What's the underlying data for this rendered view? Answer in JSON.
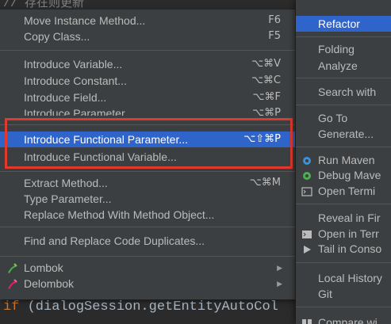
{
  "editor": {
    "top_comment": "// 存在则更新",
    "bottom_code_kw": "if",
    "bottom_code_rest": " (dialogSession.getEntityAutoCol"
  },
  "refactor_menu": {
    "items": [
      {
        "label": "Move Instance Method...",
        "shortcut": "F6"
      },
      {
        "label": "Copy Class...",
        "shortcut": "F5"
      },
      {
        "label": "Introduce Variable...",
        "shortcut": "⌥⌘V"
      },
      {
        "label": "Introduce Constant...",
        "shortcut": "⌥⌘C"
      },
      {
        "label": "Introduce Field...",
        "shortcut": "⌥⌘F"
      },
      {
        "label": "Introduce Parameter...",
        "shortcut": "⌥⌘P"
      },
      {
        "label": "Introduce Functional Parameter...",
        "shortcut": "⌥⇧⌘P"
      },
      {
        "label": "Introduce Functional Variable...",
        "shortcut": ""
      },
      {
        "label": "Extract Method...",
        "shortcut": "⌥⌘M"
      },
      {
        "label": "Type Parameter...",
        "shortcut": ""
      },
      {
        "label": "Replace Method With Method Object...",
        "shortcut": ""
      },
      {
        "label": "Find and Replace Code Duplicates...",
        "shortcut": ""
      },
      {
        "label": "Lombok",
        "shortcut": ""
      },
      {
        "label": "Delombok",
        "shortcut": ""
      }
    ]
  },
  "parent_menu": {
    "items": [
      {
        "label": "Refactor"
      },
      {
        "label": "Folding"
      },
      {
        "label": "Analyze"
      },
      {
        "label": "Search with"
      },
      {
        "label": "Go To"
      },
      {
        "label": "Generate..."
      },
      {
        "label": "Run Maven"
      },
      {
        "label": "Debug Mave"
      },
      {
        "label": "Open Termi"
      },
      {
        "label": "Reveal in Fir"
      },
      {
        "label": "Open in Terr"
      },
      {
        "label": "Tail in Conso"
      },
      {
        "label": "Local History"
      },
      {
        "label": "Git"
      },
      {
        "label": "Compare wi"
      }
    ]
  },
  "colors": {
    "selection": "#2f65ca",
    "annotation_box": "#e03a2e",
    "menu_bg": "#3c3f41"
  }
}
